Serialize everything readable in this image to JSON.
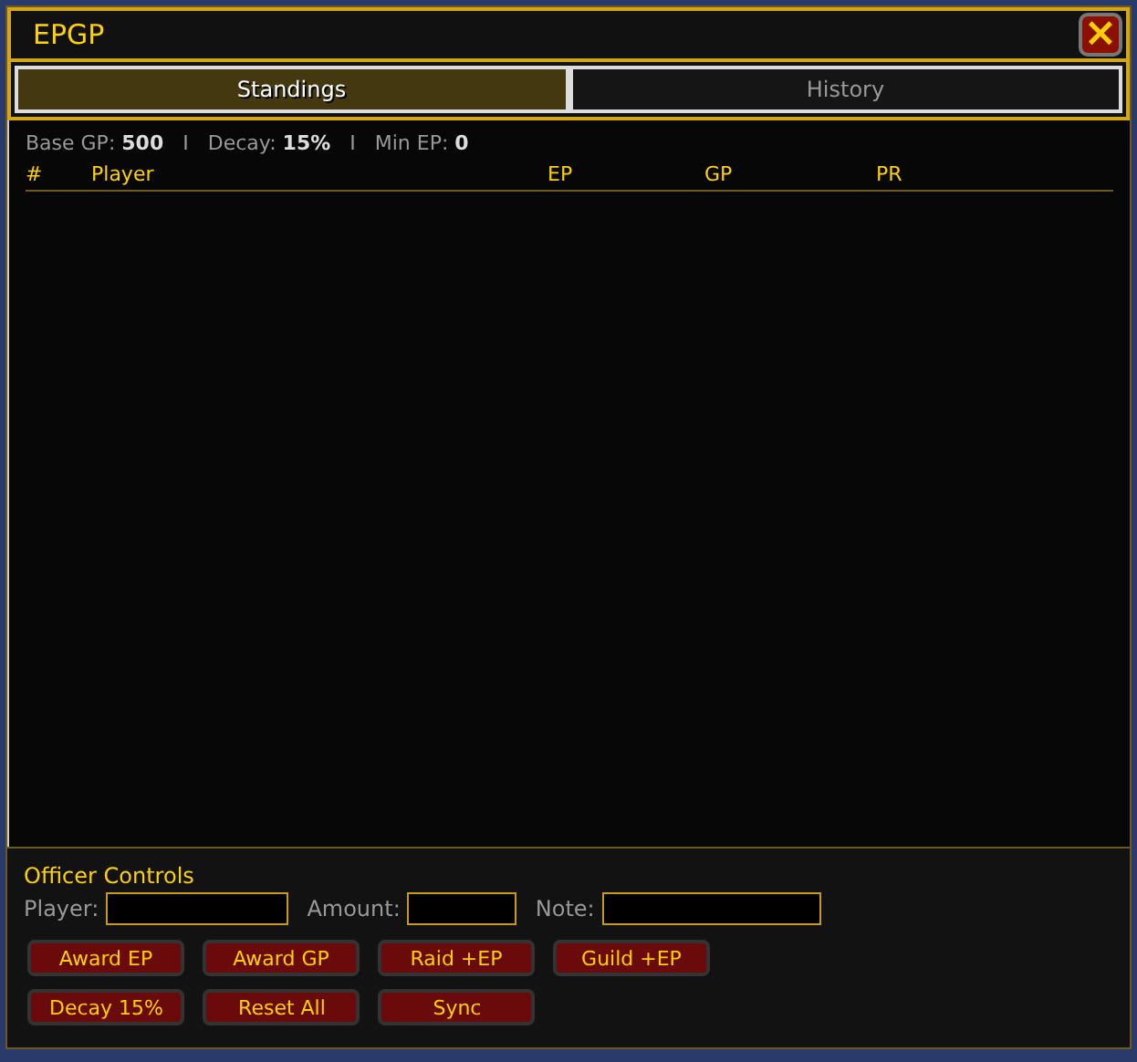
{
  "window": {
    "title": "EPGP",
    "close": "×"
  },
  "tabs": [
    {
      "label": "Standings",
      "selected": true
    },
    {
      "label": "History",
      "selected": false
    }
  ],
  "settings": "Base GP: **500**   I   Decay: **15%**   I   Min EP: **0**",
  "table": {
    "columns": [
      "#",
      "Player",
      "EP",
      "GP",
      "PR"
    ]
  },
  "officer": {
    "title": "Officer Controls",
    "fields": [
      {
        "label": "Player:"
      },
      {
        "label": "Amount:"
      },
      {
        "label": "Note:"
      }
    ],
    "button_rows": [
      [
        "Award EP",
        "Award GP",
        "Raid +EP",
        "Guild +EP"
      ],
      [
        "Decay 15%",
        "Reset All",
        "Sync"
      ]
    ]
  }
}
